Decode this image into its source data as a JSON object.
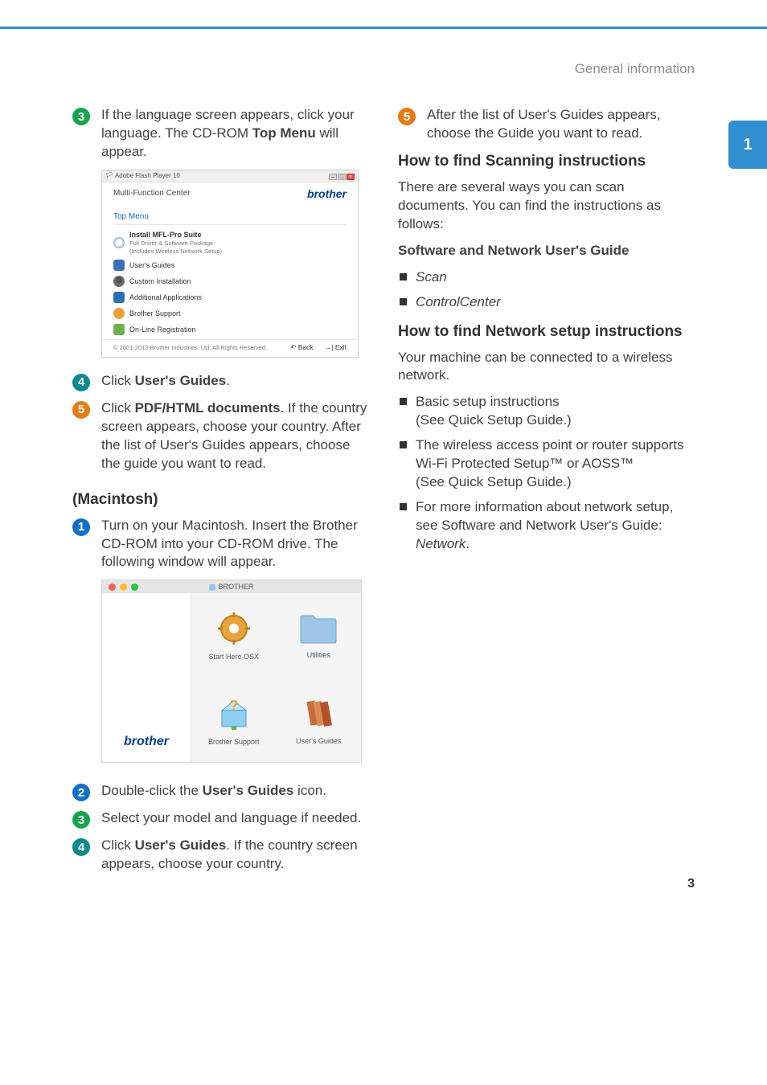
{
  "header": {
    "breadcrumb": "General information"
  },
  "section_tab": "1",
  "page_number": "3",
  "steps_win": {
    "s3": {
      "num": "3",
      "pre": "If the language screen appears, click your language. The CD-ROM ",
      "bold": "Top Menu",
      "post": " will appear."
    },
    "s4": {
      "num": "4",
      "pre": "Click ",
      "bold": "User's Guides",
      "post": "."
    },
    "s5": {
      "num": "5",
      "pre": "Click ",
      "bold": "PDF/HTML documents",
      "post": ". If the country screen appears, choose your country. After the list of User's Guides appears, choose the guide you want to read."
    }
  },
  "mac_heading": "(Macintosh)",
  "steps_mac": {
    "s1": {
      "num": "1",
      "text": "Turn on your Macintosh. Insert the Brother CD-ROM into your CD-ROM drive. The following window will appear."
    },
    "s2": {
      "num": "2",
      "pre": "Double-click the ",
      "bold": "User's Guides",
      "post": " icon."
    },
    "s3": {
      "num": "3",
      "text": "Select your model and language if needed."
    },
    "s4": {
      "num": "4",
      "pre": "Click ",
      "bold": "User's Guides",
      "post": ". If the country screen appears, choose your country."
    }
  },
  "right": {
    "s5": {
      "num": "5",
      "text": "After the list of User's Guides appears, choose the Guide you want to read."
    },
    "h_scan": "How to find Scanning instructions",
    "scan_para": "There are several ways you can scan documents. You can find the instructions as follows:",
    "sw_guide": "Software and Network User's Guide",
    "scan_item": "Scan",
    "cc_item": "ControlCenter",
    "h_net": "How to find Network setup instructions",
    "net_para": "Your machine can be connected to a wireless network.",
    "net_b1_l1": "Basic setup instructions",
    "net_b1_l2": "(See Quick Setup Guide.)",
    "net_b2_l1": "The wireless access point or router supports Wi-Fi Protected Setup™ or AOSS™",
    "net_b2_l2": "(See Quick Setup Guide.)",
    "net_b3_pre": "For more information about network setup, see Software and Network User's Guide: ",
    "net_b3_it": "Network",
    "net_b3_post": "."
  },
  "shot_win": {
    "app_title": "Adobe Flash Player 10",
    "brand": "brother",
    "mfc": "Multi-Function Center",
    "top_menu": "Top Menu",
    "mfl_title": "Install MFL-Pro Suite",
    "mfl_sub1": "Full Driver & Software Package",
    "mfl_sub2": "(Includes Wireless Network Setup)",
    "ug": "User's Guides",
    "ci": "Custom Installation",
    "aa": "Additional Applications",
    "bs": "Brother Support",
    "olr": "On-Line Registration",
    "copyright": "© 2001-2013 Brother Industries, Ltd. All Rights Reserved.",
    "back": "↶ Back",
    "exit": "→| Exit"
  },
  "shot_mac": {
    "title": "BROTHER",
    "start": "Start Here OSX",
    "util": "Utilities",
    "bs": "Brother Support",
    "ug": "User's Guides",
    "brand": "brother"
  }
}
